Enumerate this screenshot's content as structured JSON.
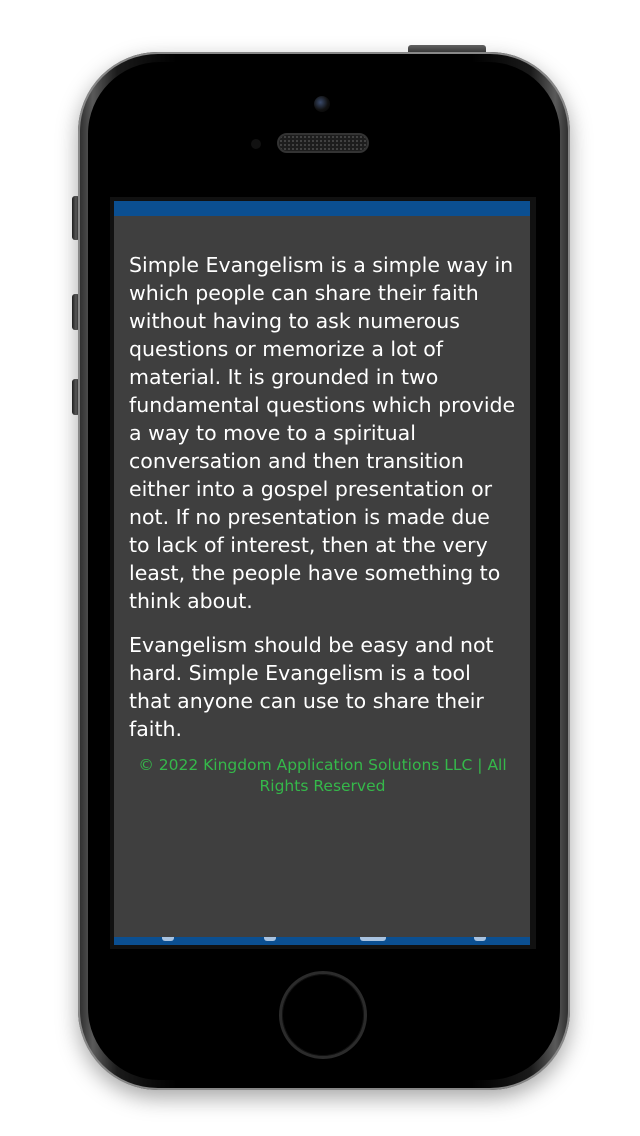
{
  "content": {
    "paragraphs": [
      "Simple Evangelism is a simple way in which people can share their faith without having to ask numerous questions or memorize a lot of material. It is grounded in two fundamental questions which provide a way to move to a spiritual conversation and then transition either into a gospel presentation or not. If no presentation is made due to lack of interest, then at the very least, the people have something to think about.",
      "Evangelism should be easy and not hard. Simple Evangelism is a tool that anyone can use to share their faith."
    ],
    "copyright": "© 2022 Kingdom Application Solutions LLC | All Rights Reserved"
  },
  "colors": {
    "bar_blue": "#0b4f91",
    "screen_background": "#3f3f3f",
    "copyright_green": "#35b84a",
    "text": "#ffffff"
  },
  "icons": [
    "camera-icon",
    "speaker-grille-icon",
    "home-button-icon"
  ]
}
